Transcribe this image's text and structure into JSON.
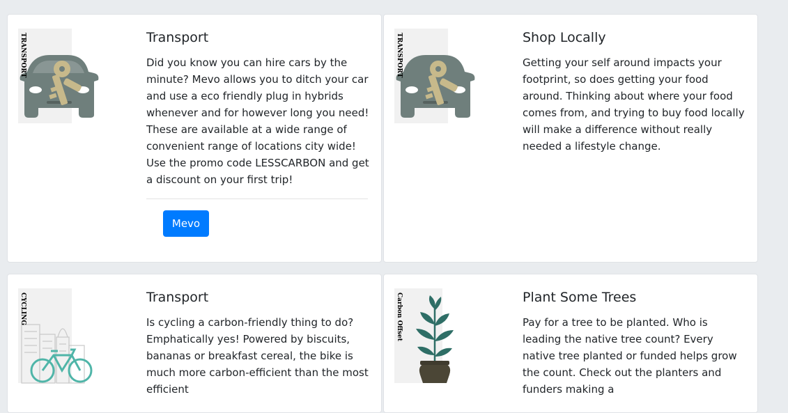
{
  "cards": [
    {
      "tag": "TRANSPORT",
      "title": "Transport",
      "body": "Did you know you can hire cars by the minute? Mevo allows you to ditch your car and use a eco friendly plug in hybrids whenever and for however long you need! These are available at a wide range of convenient range of locations city wide! Use the promo code LESSCARBON and get a discount on your first trip!",
      "button_label": "Mevo",
      "icon": "car-key-icon"
    },
    {
      "tag": "TRANSPORT",
      "title": "Shop Locally",
      "body": "Getting your self around impacts your footprint, so does getting your food around. Thinking about where your food comes from, and trying to buy food locally will make a difference without really needed a lifestyle change.",
      "icon": "car-key-icon"
    },
    {
      "tag": "CYCLING",
      "title": "Transport",
      "body": "Is cycling a carbon-friendly thing to do? Emphatically yes! Powered by biscuits, bananas or breakfast cereal, the bike is much more carbon-efficient than the most efficient",
      "icon": "bicycle-city-icon"
    },
    {
      "tag": "Carbon Offset",
      "title": "Plant Some Trees",
      "body": "Pay for a tree to be planted. Who is leading the native tree count? Every native tree planted or funded helps grow the count. Check out the planters and funders making a",
      "icon": "potted-plant-icon"
    }
  ],
  "colors": {
    "page_bg": "#e9ecef",
    "card_bg": "#ffffff",
    "button": "#007bff",
    "car": "#6f7f7c",
    "key": "#c7b98b",
    "bike": "#4fb5a8",
    "plant": "#2e6e66",
    "pot": "#4b4636"
  }
}
